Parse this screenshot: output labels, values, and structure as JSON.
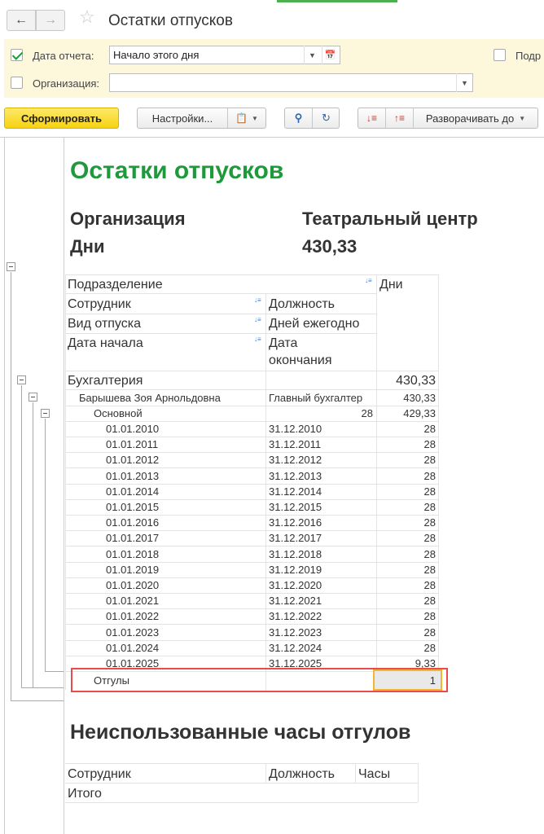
{
  "window": {
    "title": "Остатки отпусков",
    "back_icon": "arrow-left-icon",
    "forward_icon": "arrow-right-icon",
    "favorite_icon": "star-icon"
  },
  "filters": {
    "report_date": {
      "label": "Дата отчета:",
      "checked": true,
      "value": "Начало этого дня"
    },
    "organization": {
      "label": "Организация:",
      "checked": false,
      "value": ""
    },
    "extra_option": {
      "label": "Подр"
    }
  },
  "toolbar": {
    "generate_label": "Сформировать",
    "settings_label": "Настройки...",
    "expand_label": "Разворачивать до"
  },
  "report": {
    "title": "Остатки отпусков",
    "params": [
      {
        "label": "Организация",
        "value": "Театральный центр"
      },
      {
        "label": "Дни",
        "value": "430,33"
      }
    ],
    "headers": {
      "department": "Подразделение",
      "employee": "Сотрудник",
      "vacation_type": "Вид отпуска",
      "start_date": "Дата начала",
      "position": "Должность",
      "days_yearly": "Дней ежегодно",
      "end_date_line1": "Дата",
      "end_date_line2": "окончания",
      "days": "Дни"
    },
    "group": {
      "department": "Бухгалтерия",
      "department_total": "430,33",
      "employee": "Барышева Зоя Арнольдовна",
      "position": "Главный бухгалтер",
      "employee_total": "430,33",
      "vacation_type": "Основной",
      "days_yearly": "28",
      "vacation_total": "429,33"
    },
    "periods": [
      {
        "start": "01.01.2010",
        "end": "31.12.2010",
        "days": "28"
      },
      {
        "start": "01.01.2011",
        "end": "31.12.2011",
        "days": "28"
      },
      {
        "start": "01.01.2012",
        "end": "31.12.2012",
        "days": "28"
      },
      {
        "start": "01.01.2013",
        "end": "31.12.2013",
        "days": "28"
      },
      {
        "start": "01.01.2014",
        "end": "31.12.2014",
        "days": "28"
      },
      {
        "start": "01.01.2015",
        "end": "31.12.2015",
        "days": "28"
      },
      {
        "start": "01.01.2016",
        "end": "31.12.2016",
        "days": "28"
      },
      {
        "start": "01.01.2017",
        "end": "31.12.2017",
        "days": "28"
      },
      {
        "start": "01.01.2018",
        "end": "31.12.2018",
        "days": "28"
      },
      {
        "start": "01.01.2019",
        "end": "31.12.2019",
        "days": "28"
      },
      {
        "start": "01.01.2020",
        "end": "31.12.2020",
        "days": "28"
      },
      {
        "start": "01.01.2021",
        "end": "31.12.2021",
        "days": "28"
      },
      {
        "start": "01.01.2022",
        "end": "31.12.2022",
        "days": "28"
      },
      {
        "start": "01.01.2023",
        "end": "31.12.2023",
        "days": "28"
      },
      {
        "start": "01.01.2024",
        "end": "31.12.2024",
        "days": "28"
      },
      {
        "start": "01.01.2025",
        "end": "31.12.2025",
        "days": "9,33"
      }
    ],
    "timeoff": {
      "label": "Отгулы",
      "days": "1"
    }
  },
  "unused_section": {
    "title": "Неиспользованные часы отгулов",
    "headers": {
      "employee": "Сотрудник",
      "position": "Должность",
      "hours": "Часы"
    },
    "total_label": "Итого"
  }
}
